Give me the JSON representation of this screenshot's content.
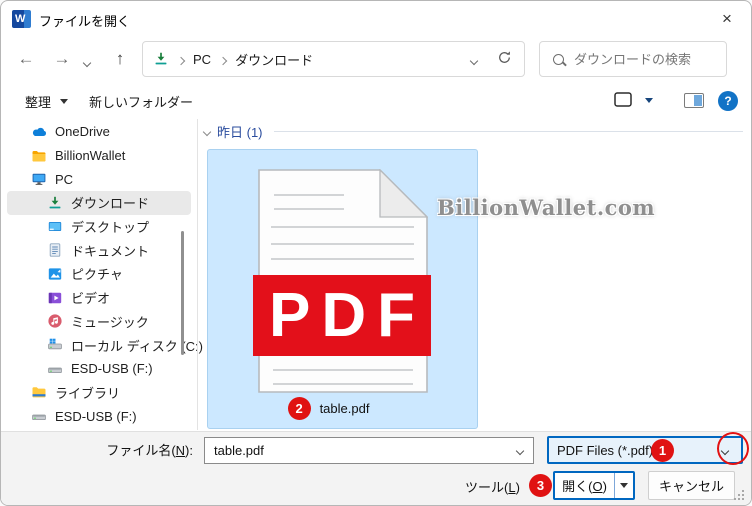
{
  "window": {
    "title": "ファイルを開く"
  },
  "icons": {
    "close": "×",
    "back": "←",
    "forward": "→",
    "up": "↑",
    "help": "?"
  },
  "nav": {
    "breadcrumb": [
      "PC",
      "ダウンロード"
    ],
    "search_placeholder": "ダウンロードの検索"
  },
  "toolbar": {
    "organize": "整理",
    "new_folder": "新しいフォルダー"
  },
  "sidebar": {
    "items": [
      {
        "id": "onedrive",
        "label": "OneDrive",
        "icon": "onedrive",
        "level": 1,
        "selected": false
      },
      {
        "id": "billionwallet",
        "label": "BillionWallet",
        "icon": "folder",
        "level": 1,
        "selected": false
      },
      {
        "id": "pc",
        "label": "PC",
        "icon": "pc",
        "level": 1,
        "selected": false
      },
      {
        "id": "downloads",
        "label": "ダウンロード",
        "icon": "downloads",
        "level": 2,
        "selected": true
      },
      {
        "id": "desktop",
        "label": "デスクトップ",
        "icon": "desktop",
        "level": 2,
        "selected": false
      },
      {
        "id": "documents",
        "label": "ドキュメント",
        "icon": "documents",
        "level": 2,
        "selected": false
      },
      {
        "id": "pictures",
        "label": "ピクチャ",
        "icon": "pictures",
        "level": 2,
        "selected": false
      },
      {
        "id": "videos",
        "label": "ビデオ",
        "icon": "videos",
        "level": 2,
        "selected": false
      },
      {
        "id": "music",
        "label": "ミュージック",
        "icon": "music",
        "level": 2,
        "selected": false
      },
      {
        "id": "local-disk-c",
        "label": "ローカル ディスク (C:)",
        "icon": "disk",
        "level": 2,
        "selected": false
      },
      {
        "id": "esd-usb-f",
        "label": "ESD-USB (F:)",
        "icon": "usb",
        "level": 2,
        "selected": false
      },
      {
        "id": "libraries",
        "label": "ライブラリ",
        "icon": "library",
        "level": 1,
        "selected": false
      },
      {
        "id": "esd-usb-f-2",
        "label": "ESD-USB (F:)",
        "icon": "usb",
        "level": 1,
        "selected": false
      }
    ]
  },
  "main": {
    "group_label": "昨日 (1)",
    "file": {
      "banner": "PDF",
      "name": "table.pdf",
      "badge": "2"
    },
    "watermark": "BillionWallet.com"
  },
  "footer": {
    "filename_label": {
      "pre": "ファイル名(",
      "key": "N",
      "post": "):"
    },
    "filename_value": "table.pdf",
    "filetype": {
      "value": "PDF Files (*.pdf)",
      "badge": "1"
    },
    "tools": {
      "pre": "ツール(",
      "key": "L",
      "post": ")",
      "badge": "3"
    },
    "open": {
      "pre": "開く(",
      "key": "O",
      "post": ")"
    },
    "cancel_label": "キャンセル"
  },
  "colors": {
    "accent": "#0067c0",
    "selection": "#cce8ff",
    "pdf_red": "#e3101a",
    "badge_red": "#e01212",
    "header_blue": "#2b4d9e",
    "watermark_gray": "#8f8f8f"
  }
}
